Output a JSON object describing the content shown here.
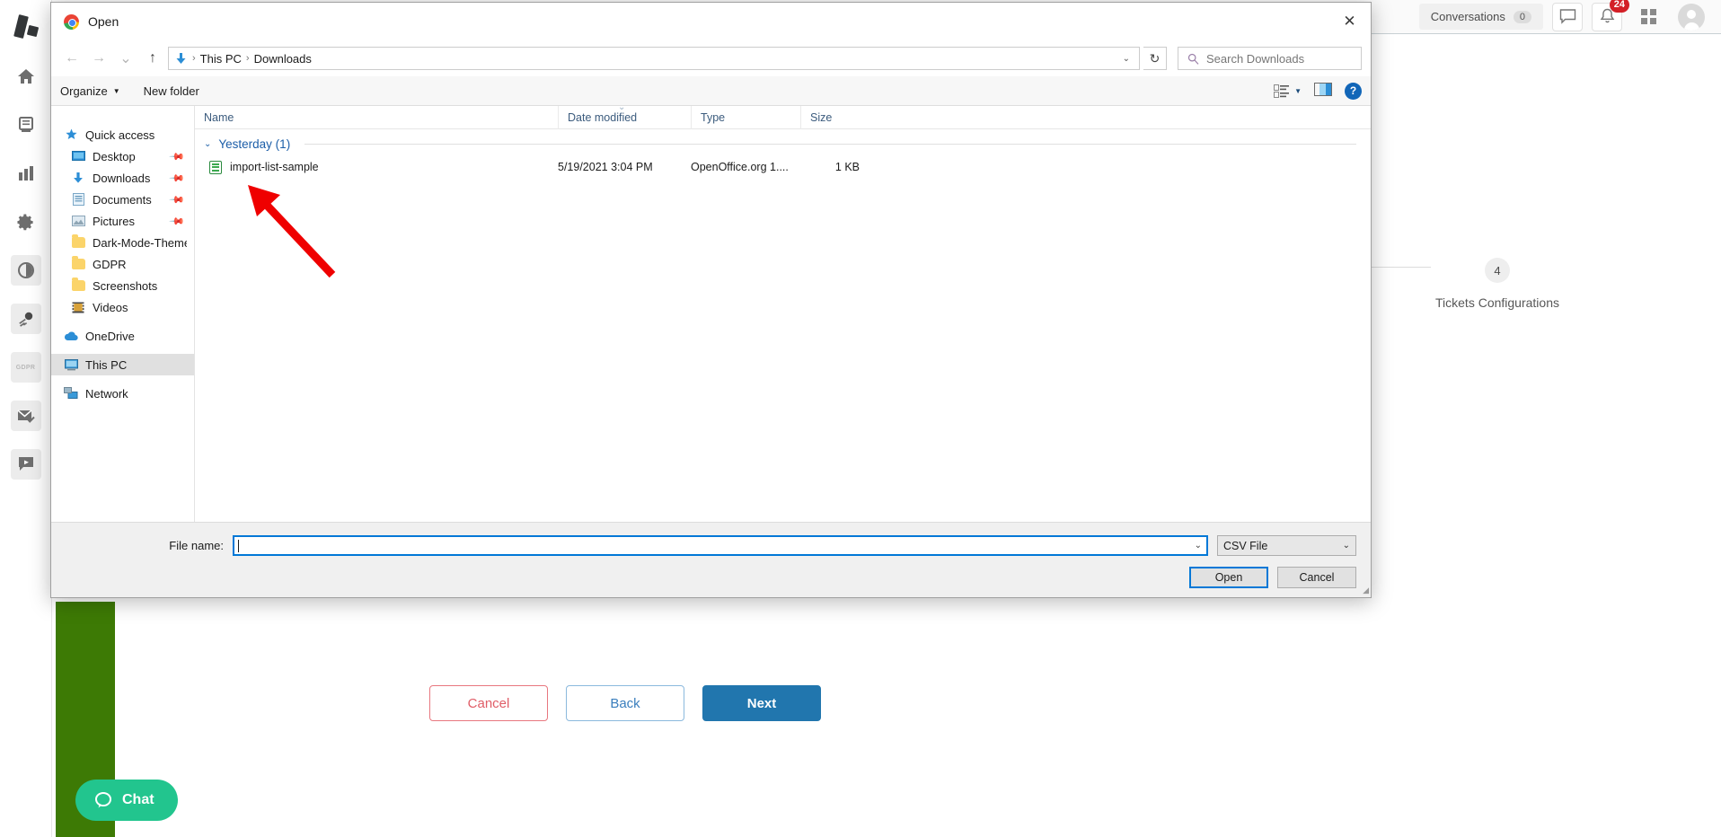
{
  "app": {
    "topbar": {
      "conversations_label": "Conversations",
      "conversations_count": "0",
      "notifications_count": "24"
    },
    "rail_items": [
      {
        "name": "home",
        "label": "Home"
      },
      {
        "name": "archive",
        "label": "Archive"
      },
      {
        "name": "reports",
        "label": "Reports"
      },
      {
        "name": "settings",
        "label": "Settings"
      },
      {
        "name": "dark-mode",
        "label": "Dark Mode"
      },
      {
        "name": "comet",
        "label": "Comet"
      },
      {
        "name": "gdpr",
        "label": "GDPR"
      },
      {
        "name": "mail",
        "label": "Mail"
      },
      {
        "name": "chat",
        "label": "Chat"
      }
    ],
    "wizard": {
      "step_number": "4",
      "step_label": "Tickets Configurations",
      "cancel_label": "Cancel",
      "back_label": "Back",
      "next_label": "Next"
    },
    "chat_widget": {
      "label": "Chat"
    },
    "colors": {
      "primary_blue": "#2176ae",
      "cancel_red": "#e05d67",
      "chat_green": "#22c58e",
      "strip_green": "#3d7a05",
      "badge_red": "#d32027"
    }
  },
  "dialog": {
    "title": "Open",
    "close_label": "✕",
    "nav": {
      "back_label": "←",
      "forward_label": "→",
      "recent_label": "⌄",
      "up_label": "↑",
      "breadcrumb": [
        "This PC",
        "Downloads"
      ],
      "breadcrumb_separator": "›",
      "dropdown_caret": "⌄",
      "refresh_label": "↻",
      "search_placeholder": "Search Downloads"
    },
    "toolbar": {
      "organize_label": "Organize",
      "organize_caret": "▼",
      "new_folder_label": "New folder",
      "view_caret": "▼",
      "help_label": "?"
    },
    "tree": [
      {
        "label": "Quick access",
        "icon": "quick-access-icon",
        "pinned": false,
        "root": true,
        "selected": false
      },
      {
        "label": "Desktop",
        "icon": "desktop-icon",
        "pinned": true,
        "root": false,
        "selected": false
      },
      {
        "label": "Downloads",
        "icon": "downloads-icon",
        "pinned": true,
        "root": false,
        "selected": false
      },
      {
        "label": "Documents",
        "icon": "documents-icon",
        "pinned": true,
        "root": false,
        "selected": false
      },
      {
        "label": "Pictures",
        "icon": "pictures-icon",
        "pinned": true,
        "root": false,
        "selected": false
      },
      {
        "label": "Dark-Mode-Theme-",
        "icon": "folder-icon",
        "pinned": false,
        "root": false,
        "selected": false
      },
      {
        "label": "GDPR",
        "icon": "folder-icon",
        "pinned": false,
        "root": false,
        "selected": false
      },
      {
        "label": "Screenshots",
        "icon": "folder-icon",
        "pinned": false,
        "root": false,
        "selected": false
      },
      {
        "label": "Videos",
        "icon": "videos-icon",
        "pinned": false,
        "root": false,
        "selected": false
      },
      {
        "label": "OneDrive",
        "icon": "onedrive-icon",
        "pinned": false,
        "root": true,
        "selected": false
      },
      {
        "label": "This PC",
        "icon": "this-pc-icon",
        "pinned": false,
        "root": true,
        "selected": true
      },
      {
        "label": "Network",
        "icon": "network-icon",
        "pinned": false,
        "root": true,
        "selected": false
      }
    ],
    "columns": {
      "name": "Name",
      "date_modified": "Date modified",
      "type": "Type",
      "size": "Size",
      "sort_caret": "⌄"
    },
    "group": {
      "collapse_caret": "⌄",
      "label": "Yesterday (1)"
    },
    "files": [
      {
        "name": "import-list-sample",
        "date_modified": "5/19/2021 3:04 PM",
        "type": "OpenOffice.org 1....",
        "size": "1 KB",
        "icon": "spreadsheet-icon"
      }
    ],
    "footer": {
      "file_name_label": "File name:",
      "file_name_value": "",
      "file_name_caret": "⌄",
      "file_type_value": "CSV File",
      "file_type_caret": "⌄",
      "open_label": "Open",
      "cancel_label": "Cancel"
    }
  }
}
